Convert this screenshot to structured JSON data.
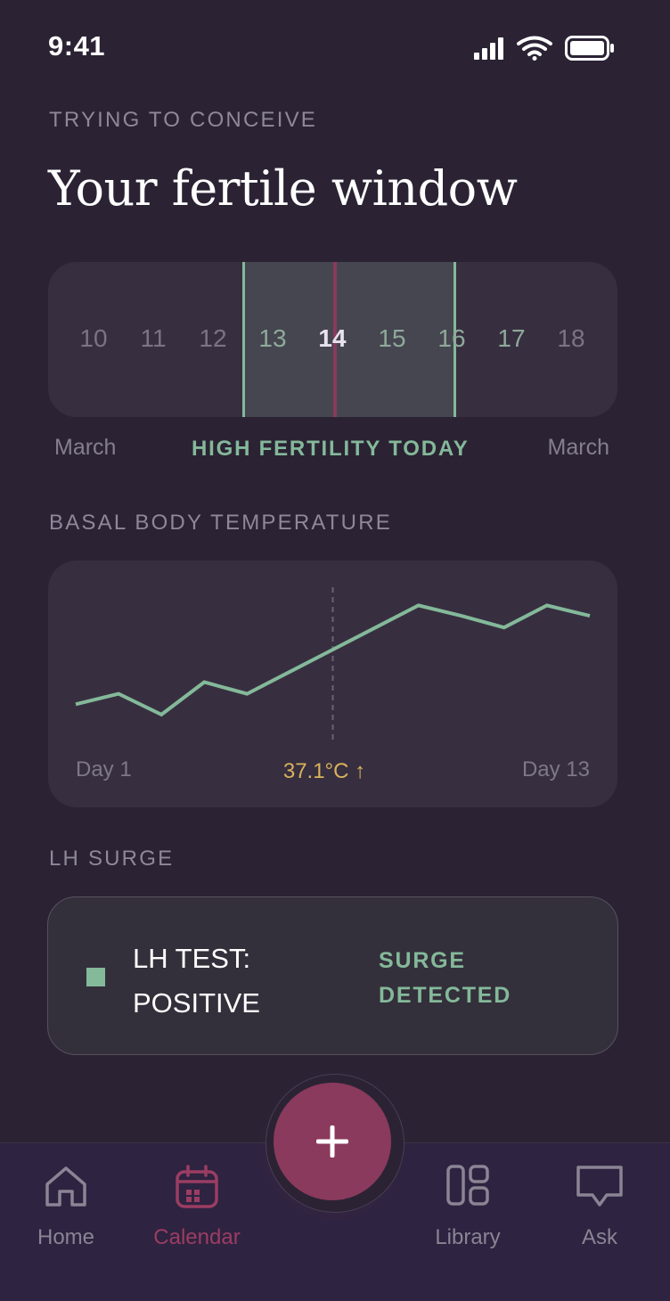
{
  "status_bar": {
    "time": "9:41"
  },
  "header": {
    "eyebrow": "TRYING TO CONCEIVE",
    "title": "Your fertile window"
  },
  "calendar_strip": {
    "days": [
      "10",
      "11",
      "12",
      "13",
      "14",
      "15",
      "16",
      "17",
      "18"
    ],
    "today": "14",
    "fertile_window": [
      "13",
      "14",
      "15",
      "16"
    ],
    "month_left": "March",
    "month_right": "March",
    "status": "HIGH FERTILITY TODAY"
  },
  "bbt": {
    "section_label": "BASAL BODY TEMPERATURE",
    "start_label": "Day 1",
    "end_label": "Day 13",
    "current_reading": "37.1°C ↑"
  },
  "chart_data": {
    "type": "line",
    "x": [
      1,
      2,
      3,
      4,
      5,
      6,
      7,
      8,
      9,
      10,
      11,
      12,
      13
    ],
    "series": [
      {
        "values": [
          36.3,
          36.38,
          36.22,
          36.47,
          36.38,
          36.55,
          36.72,
          36.89,
          37.06,
          36.98,
          36.89,
          37.06,
          36.98
        ]
      }
    ],
    "marker_day": 7,
    "ylim": [
      36.0,
      37.2
    ],
    "grid": false,
    "line_color": "#84b99a"
  },
  "lh_surge": {
    "section_label": "LH SURGE",
    "result": "LH TEST: POSITIVE",
    "status": "SURGE DETECTED"
  },
  "nav": {
    "items": [
      {
        "label": "Home",
        "icon": "home-icon"
      },
      {
        "label": "Calendar",
        "icon": "calendar-icon",
        "active": true
      },
      {
        "label": "Library",
        "icon": "library-icon"
      },
      {
        "label": "Ask",
        "icon": "chat-icon"
      }
    ],
    "fab_icon": "plus-icon"
  },
  "colors": {
    "background": "#2b2334",
    "accent": "#8a3a5c",
    "fertile": "#84b99a",
    "temperature": "#d9b25b"
  }
}
